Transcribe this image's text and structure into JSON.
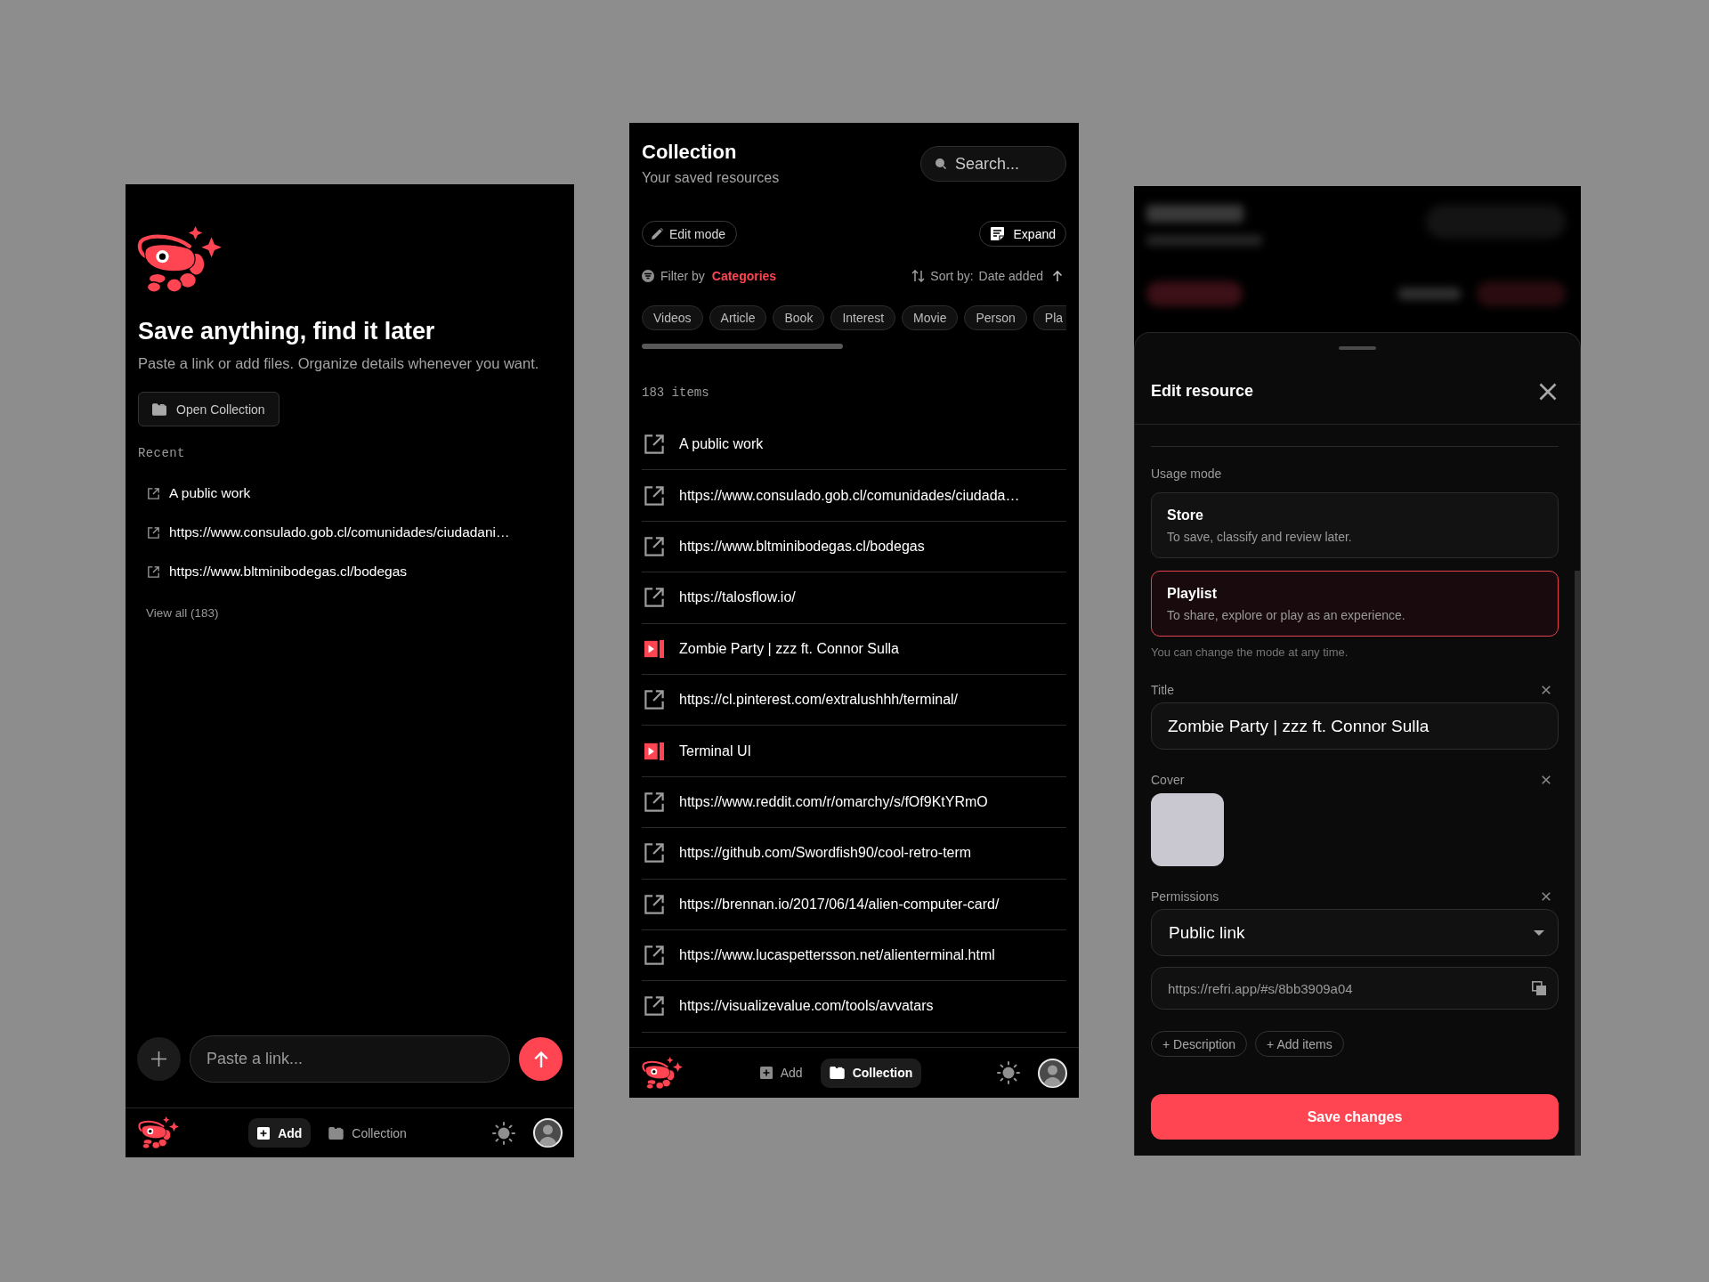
{
  "home_screen": {
    "title": "Save anything, find it later",
    "subtitle": "Paste a link or add files. Organize details whenever you want.",
    "open_button": "Open Collection",
    "recent": {
      "heading": "Recent",
      "items": [
        {
          "kind": "link",
          "title": "A public work"
        },
        {
          "kind": "link",
          "title": "https://www.consulado.gob.cl/comunidades/ciudadani…"
        },
        {
          "kind": "link",
          "title": "https://www.bltminibodegas.cl/bodegas"
        }
      ],
      "view_all": "View all (183)"
    },
    "composer": {
      "placeholder": "Paste a link..."
    },
    "nav": {
      "items": [
        {
          "kind": "add",
          "label": "Add",
          "selected": true
        },
        {
          "kind": "collection",
          "label": "Collection",
          "selected": false
        }
      ]
    }
  },
  "collection_screen": {
    "title": "Collection",
    "subtitle": "Your saved resources",
    "search": {
      "placeholder": "Search..."
    },
    "edit_button": "Edit mode",
    "expand_button": "Expand",
    "filter": {
      "label": "Filter by",
      "value": "Categories"
    },
    "sort": {
      "label": "Sort by:",
      "value": "Date added"
    },
    "chips": [
      "Videos",
      "Article",
      "Book",
      "Interest",
      "Movie",
      "Person",
      "Pla"
    ],
    "count": "183 items",
    "items": [
      {
        "kind": "link",
        "title": "A public work"
      },
      {
        "kind": "link",
        "title": "https://www.consulado.gob.cl/comunidades/ciudada…"
      },
      {
        "kind": "link",
        "title": "https://www.bltminibodegas.cl/bodegas"
      },
      {
        "kind": "link",
        "title": "https://talosflow.io/"
      },
      {
        "kind": "video",
        "title": "Zombie Party | zzz ft. Connor Sulla"
      },
      {
        "kind": "link",
        "title": "https://cl.pinterest.com/extralushhh/terminal/"
      },
      {
        "kind": "video",
        "title": "Terminal UI"
      },
      {
        "kind": "link",
        "title": "https://www.reddit.com/r/omarchy/s/fOf9KtYRmO"
      },
      {
        "kind": "link",
        "title": "https://github.com/Swordfish90/cool-retro-term"
      },
      {
        "kind": "link",
        "title": "https://brennan.io/2017/06/14/alien-computer-card/"
      },
      {
        "kind": "link",
        "title": "https://www.lucaspettersson.net/alienterminal.html"
      },
      {
        "kind": "link",
        "title": "https://visualizevalue.com/tools/avvatars"
      }
    ],
    "nav": {
      "items": [
        {
          "kind": "add",
          "label": "Add",
          "selected": false
        },
        {
          "kind": "collection",
          "label": "Collection",
          "selected": true
        }
      ]
    }
  },
  "edit_sheet": {
    "title": "Edit resource",
    "usage_mode": {
      "label": "Usage mode",
      "options": [
        {
          "title": "Store",
          "description": "To save, classify and review later.",
          "selected": false
        },
        {
          "title": "Playlist",
          "description": "To share, explore or play as an experience.",
          "selected": true
        }
      ],
      "hint": "You can change the mode at any time."
    },
    "title_field": {
      "label": "Title",
      "value": "Zombie Party | zzz ft. Connor Sulla"
    },
    "cover": {
      "label": "Cover"
    },
    "permissions": {
      "label": "Permissions",
      "value": "Public link",
      "share_link": "https://refri.app/#s/8bb3909a04"
    },
    "extra_buttons": [
      "+ Description",
      "+ Add items"
    ],
    "save_button": "Save changes"
  }
}
